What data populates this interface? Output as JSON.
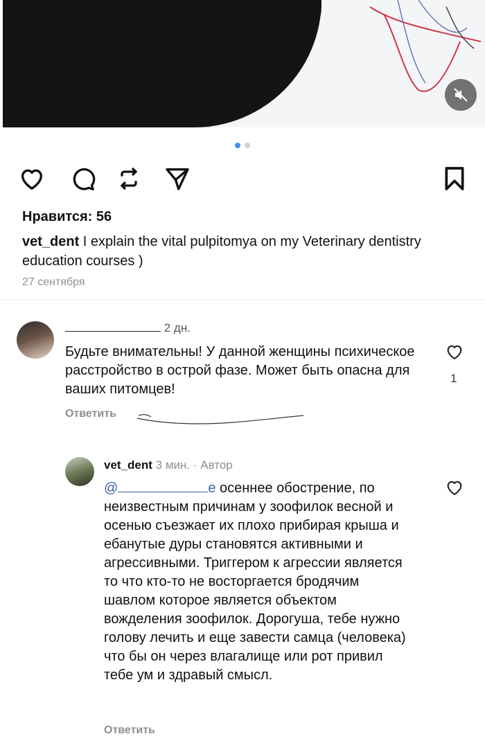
{
  "post": {
    "likes_label": "Нравится: 56",
    "username": "vet_dent",
    "caption": " I explain the vital pulpitomya on my Veterinary dentistry education courses )",
    "date": "27 сентября",
    "carousel": {
      "total": 2,
      "active": 1
    },
    "icons": [
      "heart-icon",
      "comment-icon",
      "repost-icon",
      "share-icon",
      "bookmark-icon",
      "mute-icon"
    ],
    "accent_color": "#3f8ef1"
  },
  "comments": [
    {
      "time": "2 дн.",
      "text": "Будьте внимательны! У данной женщины психическое расстройство в острой фазе. Может быть опасна для ваших питомцев!",
      "reply_label": "Ответить",
      "likes": "1"
    },
    {
      "username": "vet_dent",
      "meta": " 3 мин. · Автор",
      "mention_start": "@",
      "mention_end": "е",
      "text": " осеннее обострение, по неизвестным причинам у зоофилок весной и осенью съезжает их плохо прибирая крыша и ебанутые дуры становятся активными и агрессивными. Триггером к агрессии является то что кто-то не восторгается бродячим шавлом которое является объектом вожделения зоофилок. Дорогуша, тебе нужно голову лечить и еще завести самца (человека) что бы он через влагалище или рот  привил тебе  ум и здравый смысл.",
      "reply_label": "Ответить"
    }
  ]
}
